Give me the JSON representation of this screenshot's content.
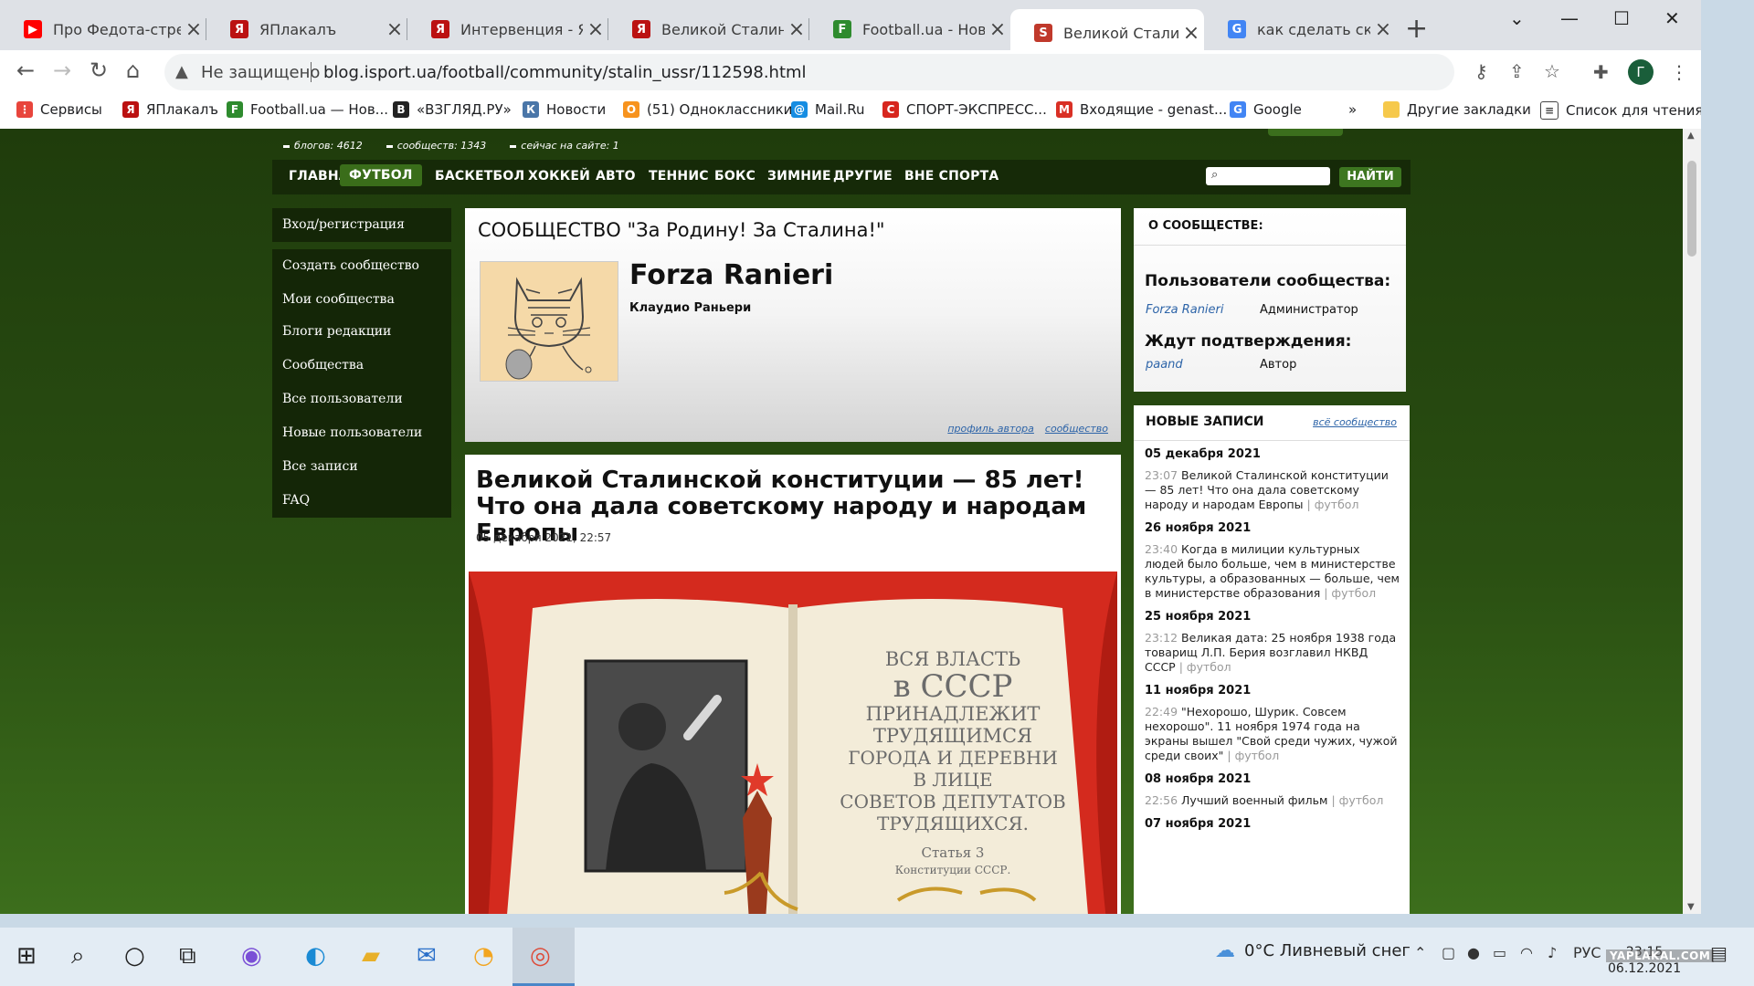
{
  "tabs": [
    {
      "title": "Про Федота-стрельца",
      "icon": "youtube-icon",
      "color": "#ff0000",
      "glyph": "▶"
    },
    {
      "title": "ЯПлакалъ",
      "icon": "yaplakal-icon",
      "color": "#b11",
      "glyph": "Я"
    },
    {
      "title": "Интервенция - ЯПлакалъ",
      "icon": "yaplakal-icon",
      "color": "#b11",
      "glyph": "Я"
    },
    {
      "title": "Великой Сталинской",
      "icon": "yaplakal-icon",
      "color": "#b11",
      "glyph": "Я"
    },
    {
      "title": "Football.ua - Новости",
      "icon": "footballua-icon",
      "color": "#2e8b2e",
      "glyph": "F"
    },
    {
      "title": "Великой Сталинской",
      "icon": "isport-icon",
      "color": "#c0392b",
      "glyph": "S"
    },
    {
      "title": "как сделать скриншот",
      "icon": "google-icon",
      "color": "#4285f4",
      "glyph": "G"
    }
  ],
  "address": {
    "security": "Не защищено",
    "url": "blog.isport.ua/football/community/stalin_ussr/112598.html"
  },
  "bookmarks": [
    {
      "label": "Сервисы",
      "icon": "apps-grid-icon",
      "color": "#e8453c",
      "glyph": "⋮"
    },
    {
      "label": "ЯПлакалъ",
      "icon": "yaplakal-icon",
      "color": "#b11",
      "glyph": "Я"
    },
    {
      "label": "Football.ua — Нов...",
      "icon": "footballua-icon",
      "color": "#2e8b2e",
      "glyph": "F"
    },
    {
      "label": "«ВЗГЛЯД.РУ»",
      "icon": "vzglyad-icon",
      "color": "#222",
      "glyph": "B"
    },
    {
      "label": "Новости",
      "icon": "vk-icon",
      "color": "#4a76a8",
      "glyph": "К"
    },
    {
      "label": "(51) Одноклассники",
      "icon": "ok-icon",
      "color": "#f7931e",
      "glyph": "О"
    },
    {
      "label": "Mail.Ru",
      "icon": "mailru-icon",
      "color": "#168de2",
      "glyph": "@"
    },
    {
      "label": "СПОРТ-ЭКСПРЕСС...",
      "icon": "sport-express-icon",
      "color": "#d7261e",
      "glyph": "С"
    },
    {
      "label": "Входящие - genast...",
      "icon": "gmail-icon",
      "color": "#d93025",
      "glyph": "M"
    },
    {
      "label": "Google",
      "icon": "google-icon",
      "color": "#4285f4",
      "glyph": "G"
    }
  ],
  "bookmarks_more": "»",
  "bookmarks_other": "Другие закладки",
  "reading_list": "Список для чтения",
  "site": {
    "stats": [
      "блогов: 4612",
      "сообществ: 1343",
      "сейчас на сайте: 1"
    ],
    "nav": [
      "ГЛАВНАЯ",
      "ФУТБОЛ",
      "БАСКЕТБОЛ",
      "ХОККЕЙ",
      "АВТО",
      "ТЕННИС",
      "БОКС",
      "ЗИМНИЕ",
      "ДРУГИЕ",
      "ВНЕ СПОРТА"
    ],
    "active_nav": 1,
    "search_button": "НАЙТИ"
  },
  "left_menu": {
    "group1": [
      "Вход/регистрация"
    ],
    "group2": [
      "Создать сообщество",
      "Мои сообщества"
    ],
    "group3": [
      "Блоги редакции",
      "Сообщества",
      "Все пользователи",
      "Новые пользователи",
      "Все записи",
      "FAQ"
    ]
  },
  "profile": {
    "community_title": "СООБЩЕСТВО \"За Родину! За Сталина!\"",
    "username": "Forza Ranieri",
    "subtitle": "Клаудио Раньери",
    "link_profile": "профиль автора",
    "link_community": "сообщество"
  },
  "article": {
    "title": "Великой Сталинской конституции — 85 лет! Что она дала советскому народу и народам Европы",
    "date": "05 декабря 2021, 22:57",
    "poster_lines": [
      "ВСЯ ВЛАСТЬ",
      "в СССР",
      "ПРИНАДЛЕЖИТ",
      "ТРУДЯЩИМСЯ",
      "ГОРОДА И ДЕРЕВНИ",
      "В ЛИЦЕ",
      "СОВЕТОВ ДЕПУТАТОВ",
      "ТРУДЯЩИХСЯ.",
      "Статья 3",
      "Конституции СССР."
    ]
  },
  "about": {
    "header": "О СООБЩЕСТВЕ:",
    "members_title": "Пользователи сообщества:",
    "member_name": "Forza Ranieri",
    "member_role": "Администратор",
    "pending_title": "Ждут подтверждения:",
    "pending_name": "paand",
    "pending_role": "Автор"
  },
  "new_posts": {
    "header": "НОВЫЕ ЗАПИСИ",
    "all_link": "всё сообщество",
    "feed": [
      {
        "date": "05 декабря 2021",
        "entries": [
          {
            "time": "23:07",
            "text": "Великой Сталинской конституции — 85 лет! Что она дала советскому народу и народам Европы",
            "tag": "футбол"
          }
        ]
      },
      {
        "date": "26 ноября 2021",
        "entries": [
          {
            "time": "23:40",
            "text": "Когда в милиции культурных людей было больше, чем в министерстве культуры, а образованных — больше, чем в министерстве образования",
            "tag": "футбол"
          }
        ]
      },
      {
        "date": "25 ноября 2021",
        "entries": [
          {
            "time": "23:12",
            "text": "Великая дата: 25 ноября 1938 года товарищ Л.П. Берия возглавил НКВД СССР",
            "tag": "футбол"
          }
        ]
      },
      {
        "date": "11 ноября 2021",
        "entries": [
          {
            "time": "22:49",
            "text": "\"Нехорошо, Шурик. Совсем нехорошо\". 11 ноября 1974 года на экраны вышел \"Свой среди чужих, чужой среди своих\"",
            "tag": "футбол"
          }
        ]
      },
      {
        "date": "08 ноября 2021",
        "entries": [
          {
            "time": "22:56",
            "text": "Лучший военный фильм",
            "tag": "футбол"
          }
        ]
      },
      {
        "date": "07 ноября 2021",
        "entries": []
      }
    ]
  },
  "taskbar": {
    "weather": "0°C  Ливневый снег",
    "lang": "РУС",
    "time": "23:15",
    "date": "06.12.2021",
    "watermark": "YAPLAKAL.COM"
  }
}
